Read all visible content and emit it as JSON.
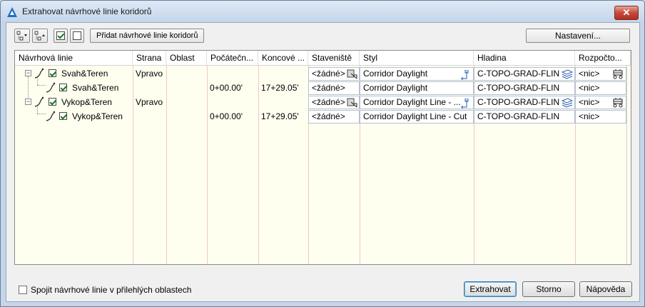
{
  "window": {
    "title": "Extrahovat návrhové linie koridorů",
    "close_glyph": "✕"
  },
  "toolbar": {
    "add_button_label": "Přidat návrhové linie koridorů",
    "settings_button_label": "Nastavení..."
  },
  "columns": [
    "Návrhová linie",
    "Strana",
    "Oblast",
    "Počátečn...",
    "Koncové ...",
    "Staveniště",
    "Styl",
    "Hladina",
    "Rozpočto..."
  ],
  "rows": [
    {
      "name": "Svah&Teren",
      "side": "Vpravo",
      "region": "",
      "start": "",
      "end": "",
      "site": "<žádné>",
      "style": "Corridor Daylight",
      "layer": "C-TOPO-GRAD-FLIN",
      "budget": "<nic>",
      "checked": true
    },
    {
      "name": "Svah&Teren",
      "side": "",
      "region": "",
      "start": "0+00.00'",
      "end": "17+29.05'",
      "site": "<žádné>",
      "style": "Corridor Daylight",
      "layer": "C-TOPO-GRAD-FLIN",
      "budget": "<nic>",
      "checked": true
    },
    {
      "name": "Vykop&Teren",
      "side": "Vpravo",
      "region": "",
      "start": "",
      "end": "",
      "site": "<žádné>",
      "style": "Corridor Daylight Line - ...",
      "layer": "C-TOPO-GRAD-FLIN",
      "budget": "<nic>",
      "checked": true
    },
    {
      "name": "Vykop&Teren",
      "side": "",
      "region": "",
      "start": "0+00.00'",
      "end": "17+29.05'",
      "site": "<žádné>",
      "style": "Corridor Daylight Line - Cut",
      "layer": "C-TOPO-GRAD-FLIN",
      "budget": "<nic>",
      "checked": true
    }
  ],
  "footer": {
    "join_label": "Spojit návrhové linie v přilehlých oblastech",
    "join_checked": false,
    "extract_label": "Extrahovat",
    "cancel_label": "Storno",
    "help_label": "Nápověda"
  },
  "colors": {
    "grid_background": "#fffff0",
    "column_separator": "#efc8c8",
    "close_button": "#c4493a",
    "checkmark": "#1a7a1a"
  },
  "icons": [
    "app-icon",
    "expand-all-icon",
    "collapse-all-icon",
    "select-all-icon",
    "clear-all-icon",
    "alignment-icon",
    "site-pick-icon",
    "style-edit-icon",
    "layer-icon",
    "budget-icon",
    "close-icon"
  ]
}
